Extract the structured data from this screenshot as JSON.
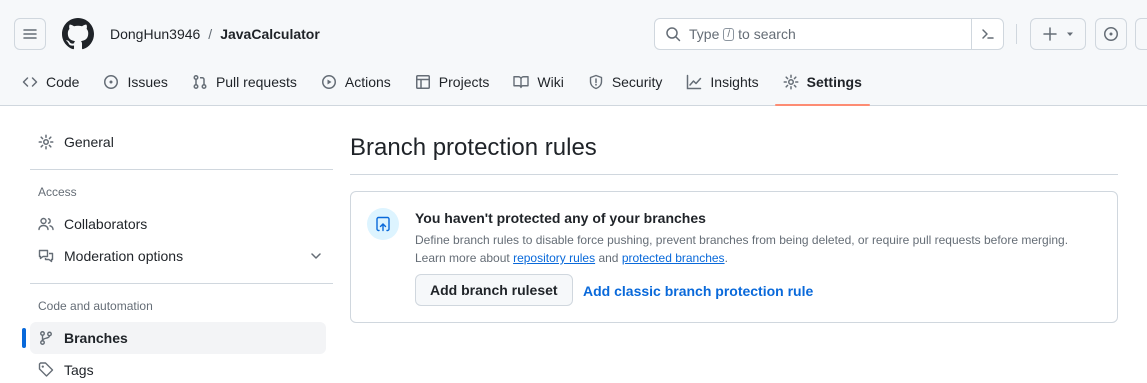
{
  "header": {
    "owner": "DongHun3946",
    "separator": "/",
    "repo": "JavaCalculator",
    "search_prefix": "Type",
    "search_key": "/",
    "search_suffix": "to search",
    "plus_label": "+"
  },
  "tabs": [
    {
      "label": "Code",
      "icon": "code-icon"
    },
    {
      "label": "Issues",
      "icon": "issue-opened-icon"
    },
    {
      "label": "Pull requests",
      "icon": "git-pull-request-icon"
    },
    {
      "label": "Actions",
      "icon": "play-icon"
    },
    {
      "label": "Projects",
      "icon": "table-icon"
    },
    {
      "label": "Wiki",
      "icon": "book-icon"
    },
    {
      "label": "Security",
      "icon": "shield-icon"
    },
    {
      "label": "Insights",
      "icon": "graph-icon"
    },
    {
      "label": "Settings",
      "icon": "gear-icon",
      "selected": true
    }
  ],
  "sidebar": {
    "general": "General",
    "access_heading": "Access",
    "collaborators": "Collaborators",
    "moderation": "Moderation options",
    "code_heading": "Code and automation",
    "branches": "Branches",
    "tags": "Tags"
  },
  "main": {
    "title": "Branch protection rules",
    "blank_title": "You haven't protected any of your branches",
    "blank_desc_line1": "Define branch rules to disable force pushing, prevent branches from being deleted, or require pull requests before merging.",
    "learn_prefix": "Learn more about",
    "link_repository_rules": "repository rules",
    "and_word": "and",
    "link_protected_branches": "protected branches",
    "period": ".",
    "add_ruleset_button": "Add branch ruleset",
    "add_classic_link": "Add classic branch protection rule"
  },
  "colors": {
    "accent": "#0969da",
    "tab_underline": "#fd8c73",
    "header_bg": "#f6f8fa",
    "border": "#d0d7de"
  }
}
